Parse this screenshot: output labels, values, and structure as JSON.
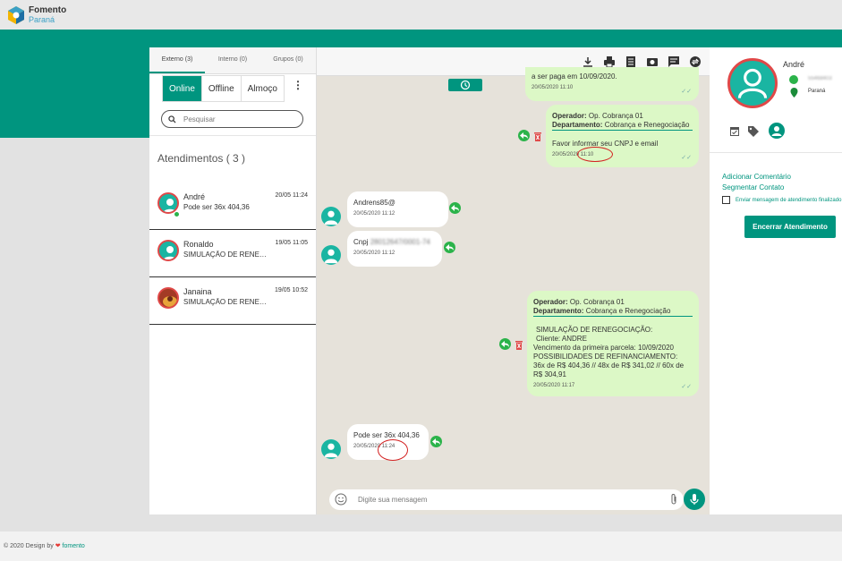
{
  "brand": {
    "line1": "Fomento",
    "line2": "Paraná"
  },
  "footer": {
    "text": "© 2020 Design by",
    "brand": "fomento"
  },
  "tabs": [
    {
      "label": "Externo (3)"
    },
    {
      "label": "Interno (0)"
    },
    {
      "label": "Grupos (0)"
    }
  ],
  "status": {
    "online": "Online",
    "offline": "Offline",
    "almoco": "Almoço"
  },
  "search": {
    "placeholder": "Pesquisar"
  },
  "list_title": "Atendimentos ( 3 )",
  "contacts": [
    {
      "name": "André",
      "message": "Pode ser 36x 404,36",
      "time": "20/05 11:24"
    },
    {
      "name": "Ronaldo",
      "message": "SIMULAÇÃO DE RENEGOCIAÇÃO:",
      "time": "19/05 11:05"
    },
    {
      "name": "Janaina",
      "message": "SIMULAÇÃO DE RENEGOCIAÇÃO:",
      "time": "19/05 10:52"
    }
  ],
  "chat": {
    "top_partial": {
      "text": "a ser paga em 10/09/2020.",
      "time": "20/05/2020 11:10"
    },
    "out1": {
      "operator_label": "Operador:",
      "operator": "Op. Cobrança 01",
      "dept_label": "Departamento:",
      "dept": "Cobrança e Renegociação",
      "text": "Favor informar seu CNPJ e email",
      "time": "20/05/2020 11:10"
    },
    "in1": {
      "text": "Andrens85@",
      "time": "20/05/2020 11:12"
    },
    "in2": {
      "text": "Cnpj",
      "masked": "28012647/0001-74",
      "time": "20/05/2020 11:12"
    },
    "out2": {
      "operator_label": "Operador:",
      "operator": "Op. Cobrança 01",
      "dept_label": "Departamento:",
      "dept": "Cobrança e Renegociação",
      "lines": [
        "SIMULAÇÃO DE RENEGOCIAÇÃO:",
        "Cliente: ANDRE",
        "Vencimento da primeira parcela: 10/09/2020",
        "POSSIBILIDADES DE REFINANCIAMENTO:",
        "36x de R$ 404,36 // 48x de R$ 341,02 // 60x de R$ 304,91"
      ],
      "time": "20/05/2020 11:17"
    },
    "in3": {
      "text": "Pode ser 36x 404,36",
      "time": "20/05/2020 11:24"
    },
    "composer_placeholder": "Digite sua mensagem"
  },
  "profile": {
    "name": "André",
    "phone": "55468403",
    "state": "Paraná",
    "add_comment": "Adicionar Comentário",
    "segment": "Segmentar Contato",
    "checkbox_label": "Enviar mensagem de atendimento finalizado",
    "end_button": "Encerrar Atendimento"
  },
  "colors": {
    "accent": "#00957f",
    "bubble_out": "#dcf8c6",
    "danger": "#e04848"
  }
}
